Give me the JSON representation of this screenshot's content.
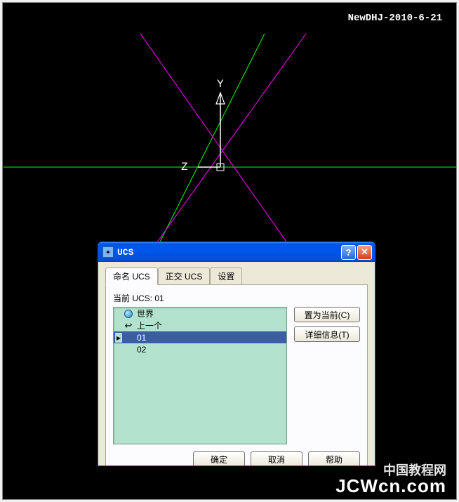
{
  "watermark": {
    "top": "NewDHJ-2010-6-21",
    "bottom_line1": "中国教程网",
    "bottom_line2": "JCWcn.com"
  },
  "axes": {
    "y_label": "Y",
    "z_label": "Z"
  },
  "dialog": {
    "title": "UCS",
    "tabs": {
      "named": "命名 UCS",
      "ortho": "正交 UCS",
      "settings": "设置"
    },
    "current_label": "当前 UCS:  01",
    "items": {
      "world": "世界",
      "previous": "上一个",
      "item01": "01",
      "item02": "02"
    },
    "buttons": {
      "set_current": "置为当前(C)",
      "details": "详细信息(T)",
      "ok": "确定",
      "cancel": "取消",
      "help": "帮助"
    }
  }
}
